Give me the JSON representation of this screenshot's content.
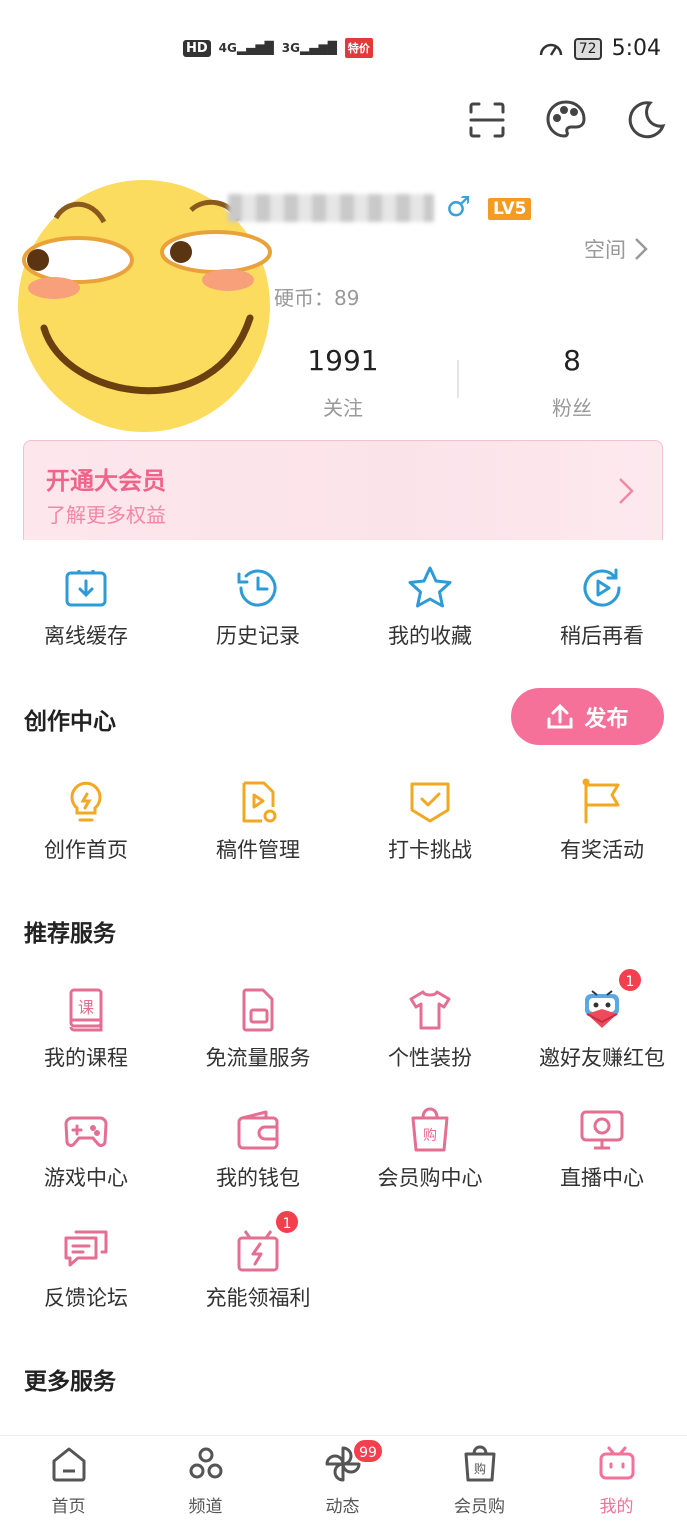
{
  "status_bar": {
    "hd": "HD",
    "signal_1": "4G",
    "signal_2": "3G",
    "sale_badge": "特价",
    "battery": "72",
    "time": "5:04"
  },
  "profile": {
    "gender_symbol": "♂",
    "level": "LV5",
    "space_label": "空间",
    "coins_label": "硬币：89",
    "following_count": "1991",
    "following_label": "关注",
    "fans_count": "8",
    "fans_label": "粉丝"
  },
  "vip": {
    "title": "开通大会员",
    "subtitle": "了解更多权益"
  },
  "quick_actions": [
    {
      "label": "离线缓存",
      "icon": "download-cache-icon"
    },
    {
      "label": "历史记录",
      "icon": "history-clock-icon"
    },
    {
      "label": "我的收藏",
      "icon": "star-icon"
    },
    {
      "label": "稍后再看",
      "icon": "watch-later-icon"
    }
  ],
  "creation": {
    "title": "创作中心",
    "publish_label": "发布",
    "items": [
      {
        "label": "创作首页",
        "icon": "lightbulb-icon"
      },
      {
        "label": "稿件管理",
        "icon": "manuscript-icon"
      },
      {
        "label": "打卡挑战",
        "icon": "checkin-badge-icon"
      },
      {
        "label": "有奖活动",
        "icon": "flag-icon"
      }
    ]
  },
  "recommended": {
    "title": "推荐服务",
    "items": [
      {
        "label": "我的课程",
        "icon": "course-book-icon",
        "badge": ""
      },
      {
        "label": "免流量服务",
        "icon": "sim-card-icon",
        "badge": ""
      },
      {
        "label": "个性装扮",
        "icon": "tshirt-icon",
        "badge": ""
      },
      {
        "label": "邀好友赚红包",
        "icon": "tv-mascot-envelope-icon",
        "badge": "1"
      },
      {
        "label": "游戏中心",
        "icon": "gamepad-icon",
        "badge": ""
      },
      {
        "label": "我的钱包",
        "icon": "wallet-icon",
        "badge": ""
      },
      {
        "label": "会员购中心",
        "icon": "shopping-bag-icon",
        "badge": ""
      },
      {
        "label": "直播中心",
        "icon": "live-tv-icon",
        "badge": ""
      },
      {
        "label": "反馈论坛",
        "icon": "chat-bubbles-icon",
        "badge": ""
      },
      {
        "label": "充能领福利",
        "icon": "gift-bolt-icon",
        "badge": "1"
      }
    ]
  },
  "more": {
    "title": "更多服务"
  },
  "bottom_nav": [
    {
      "label": "首页",
      "icon": "home-icon",
      "badge": ""
    },
    {
      "label": "频道",
      "icon": "channels-icon",
      "badge": ""
    },
    {
      "label": "动态",
      "icon": "pinwheel-icon",
      "badge": "99"
    },
    {
      "label": "会员购",
      "icon": "shop-bag-icon",
      "badge": ""
    },
    {
      "label": "我的",
      "icon": "tv-mine-icon",
      "badge": ""
    }
  ],
  "colors": {
    "accent_pink": "#f5719a",
    "icon_blue": "#2e9bd6",
    "icon_orange": "#f2a823",
    "icon_pink": "#e56e93",
    "badge_red": "#f43f4f"
  }
}
